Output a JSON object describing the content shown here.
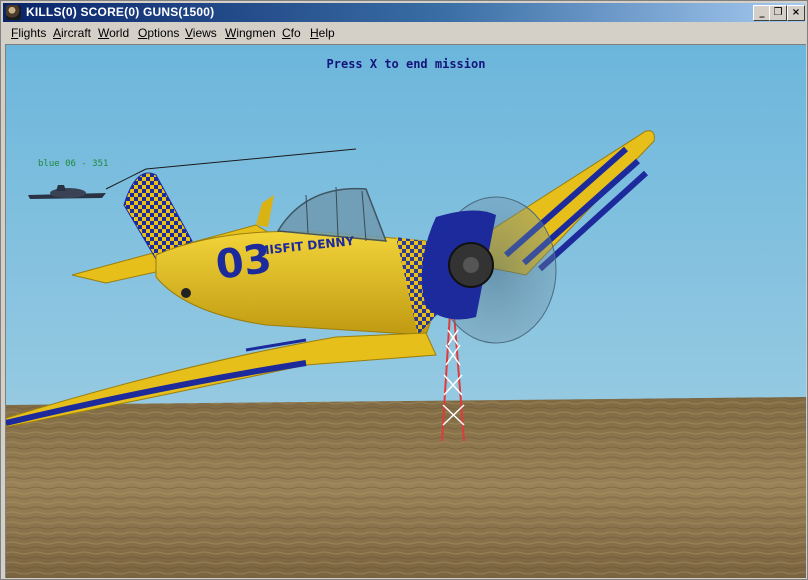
{
  "window": {
    "title": "KILLS(0) SCORE(0) GUNS(1500)",
    "controls": {
      "minimize": "_",
      "restore": "❐",
      "close": "×"
    }
  },
  "menu": [
    {
      "label": "Flights",
      "mnemonic": "F",
      "rest": "lights"
    },
    {
      "label": "Aircraft",
      "mnemonic": "A",
      "rest": "ircraft"
    },
    {
      "label": "World",
      "mnemonic": "W",
      "rest": "orld"
    },
    {
      "label": "Options",
      "mnemonic": "O",
      "rest": "ptions"
    },
    {
      "label": "Views",
      "mnemonic": "V",
      "rest": "iews"
    },
    {
      "label": "Wingmen",
      "mnemonic": "W",
      "rest": "ingmen"
    },
    {
      "label": "Cfo",
      "mnemonic": "C",
      "rest": "fo"
    },
    {
      "label": "Help",
      "mnemonic": "H",
      "rest": "elp"
    }
  ],
  "hud": {
    "mission_message": "Press X to end mission",
    "target_callsign": "blue 06 - 351"
  },
  "aircraft": {
    "number": "03",
    "nose_art": "MISFIT DENNY",
    "colors": {
      "body": "#e8c21a",
      "stripe": "#1c2a9c",
      "canopy": "#6f9cb3"
    }
  },
  "scene": {
    "sky_top": "#6cb6dc",
    "sky_bottom": "#a6d2e4",
    "ground": "#8c7650"
  }
}
